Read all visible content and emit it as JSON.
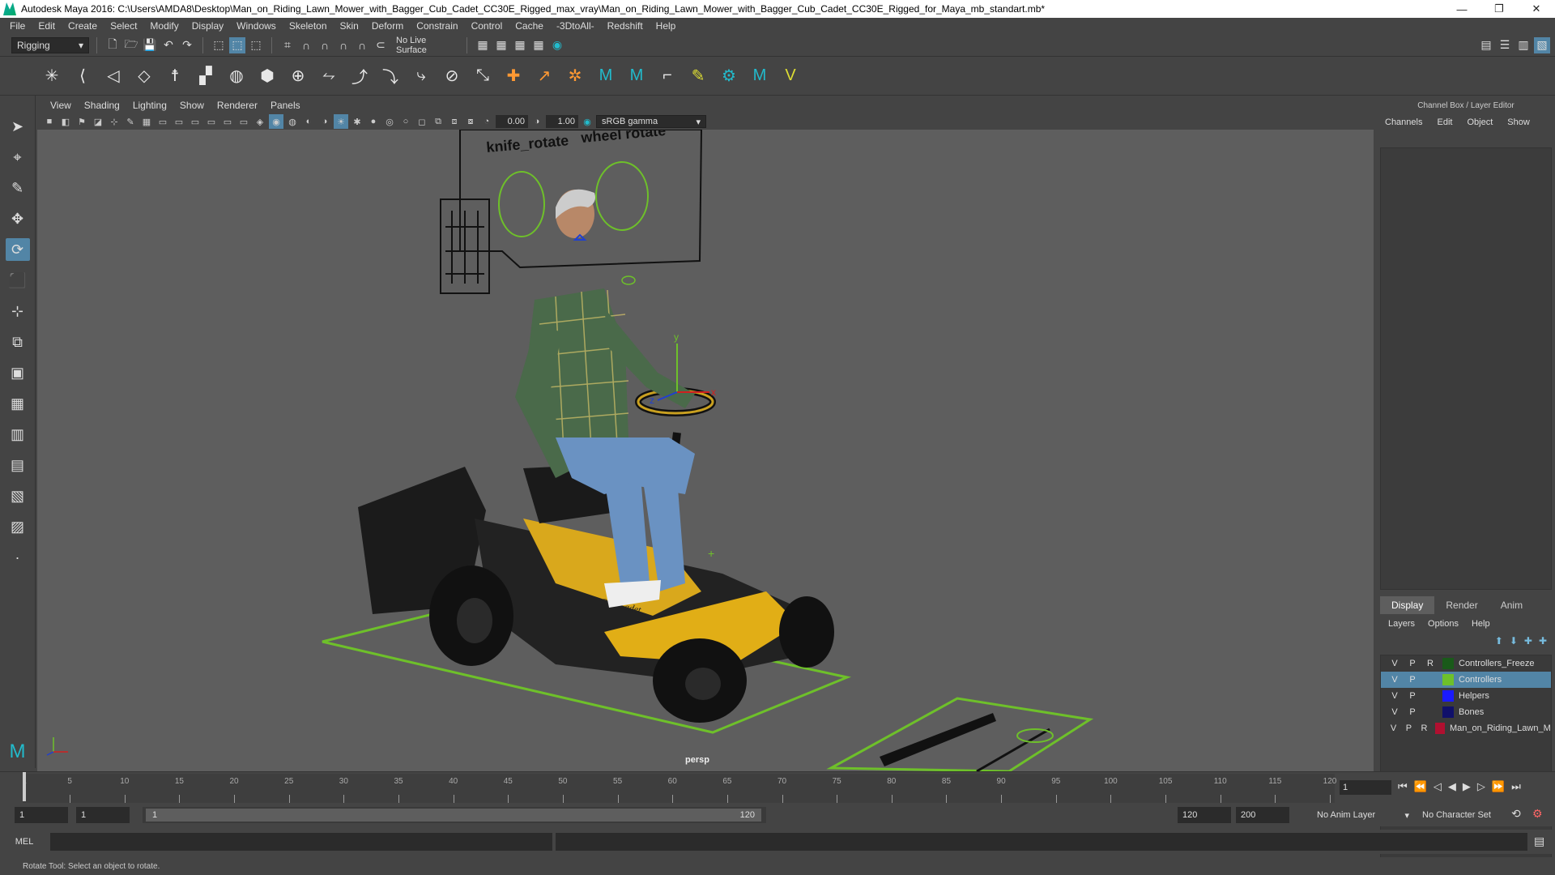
{
  "window": {
    "title": "Autodesk Maya 2016: C:\\Users\\AMDA8\\Desktop\\Man_on_Riding_Lawn_Mower_with_Bagger_Cub_Cadet_CC30E_Rigged_max_vray\\Man_on_Riding_Lawn_Mower_with_Bagger_Cub_Cadet_CC30E_Rigged_for_Maya_mb_standart.mb*",
    "minimize": "—",
    "restore": "❐",
    "close": "✕"
  },
  "menus": [
    "File",
    "Edit",
    "Create",
    "Select",
    "Modify",
    "Display",
    "Windows",
    "Skeleton",
    "Skin",
    "Deform",
    "Constrain",
    "Control",
    "Cache",
    "-3DtoAll-",
    "Redshift",
    "Help"
  ],
  "status": {
    "menuset": "Rigging",
    "live_surface": "No Live Surface"
  },
  "viewport": {
    "menus": [
      "View",
      "Shading",
      "Lighting",
      "Show",
      "Renderer",
      "Panels"
    ],
    "exposure": "0.00",
    "gamma": "1.00",
    "colorspace": "sRGB gamma",
    "camera": "persp",
    "scene_labels": {
      "knife": "knife_rotate",
      "wheel": "wheel rotate",
      "brand": "Cub Cadet",
      "axis_y": "y",
      "axis_x": "x",
      "axis_z": "z"
    }
  },
  "right_panel": {
    "title": "Channel Box / Layer Editor",
    "channel_menus": [
      "Channels",
      "Edit",
      "Object",
      "Show"
    ],
    "tabs": [
      "Display",
      "Render",
      "Anim"
    ],
    "active_tab": "Display",
    "layer_menus": [
      "Layers",
      "Options",
      "Help"
    ],
    "layers": [
      {
        "v": "V",
        "p": "P",
        "r": "R",
        "name": "Controllers_Freeze",
        "color": "#1a5a1a",
        "selected": false
      },
      {
        "v": "V",
        "p": "P",
        "r": "",
        "name": "Controllers",
        "color": "#6ec02a",
        "selected": true
      },
      {
        "v": "V",
        "p": "P",
        "r": "",
        "name": "Helpers",
        "color": "#1a1aff",
        "selected": false
      },
      {
        "v": "V",
        "p": "P",
        "r": "",
        "name": "Bones",
        "color": "#10106a",
        "selected": false
      },
      {
        "v": "V",
        "p": "P",
        "r": "R",
        "name": "Man_on_Riding_Lawn_Mowe",
        "color": "#b01030",
        "selected": false
      }
    ]
  },
  "timeline": {
    "ticks": [
      "5",
      "10",
      "15",
      "20",
      "25",
      "30",
      "35",
      "40",
      "45",
      "50",
      "55",
      "60",
      "65",
      "70",
      "75",
      "80",
      "85",
      "90",
      "95",
      "100",
      "105",
      "110",
      "115",
      "120"
    ],
    "start_label": "1",
    "current_frame": "1"
  },
  "range": {
    "start": "1",
    "inner_start": "1",
    "slider_start": "1",
    "slider_end": "120",
    "end": "120",
    "max_end": "200",
    "anim_layer": "No Anim Layer",
    "char_set": "No Character Set"
  },
  "mel": {
    "label": "MEL"
  },
  "help_line": "Rotate Tool: Select an object to rotate."
}
